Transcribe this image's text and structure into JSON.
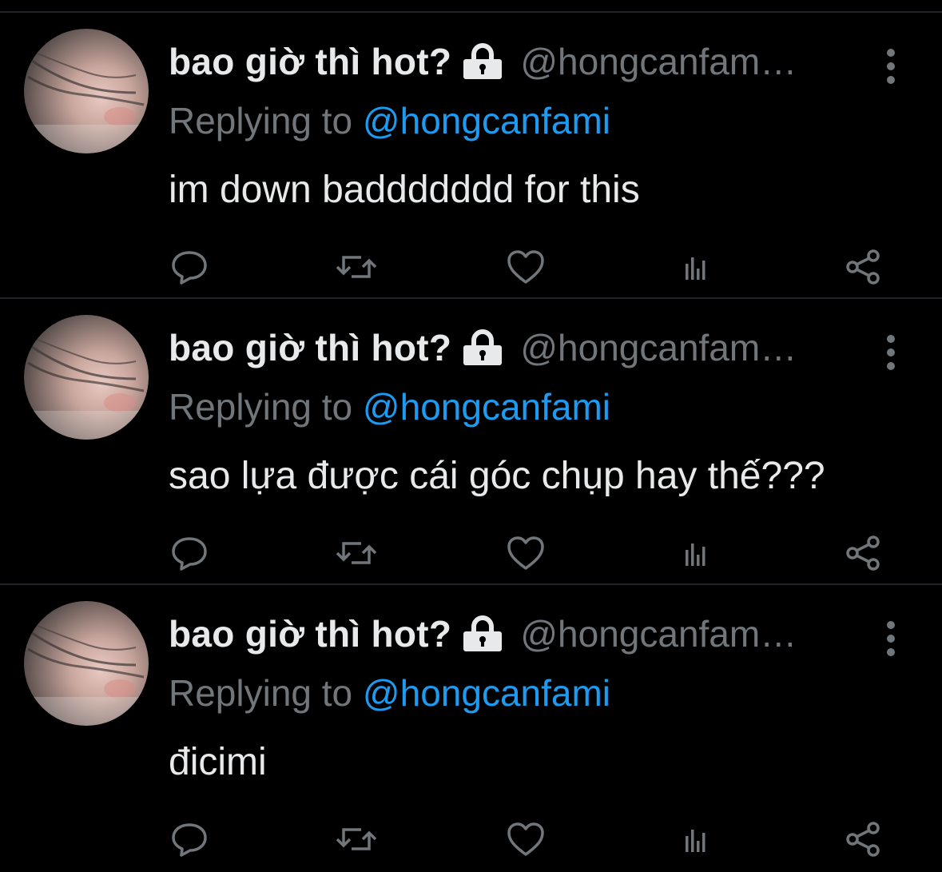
{
  "tweets": [
    {
      "display_name": "bao giờ thì hot?",
      "handle": "@hongcanfam…",
      "replying_prefix": "Replying to ",
      "replying_to": "@hongcanfami",
      "text": "im down baddddddd for this"
    },
    {
      "display_name": "bao giờ thì hot?",
      "handle": "@hongcanfam…",
      "replying_prefix": "Replying to ",
      "replying_to": "@hongcanfami",
      "text": "sao lựa được cái góc chụp hay thế???"
    },
    {
      "display_name": "bao giờ thì hot?",
      "handle": "@hongcanfam…",
      "replying_prefix": "Replying to ",
      "replying_to": "@hongcanfami",
      "text": "đicimi"
    }
  ],
  "icons": {
    "lock": "lock-icon",
    "more": "more-vertical-icon",
    "reply": "reply-icon",
    "retweet": "retweet-icon",
    "like": "heart-icon",
    "views": "views-icon",
    "share": "share-icon"
  },
  "colors": {
    "background": "#000000",
    "primary_text": "#e7e9ea",
    "secondary_text": "#71767b",
    "mention": "#1d9bf0",
    "divider": "#202327"
  }
}
